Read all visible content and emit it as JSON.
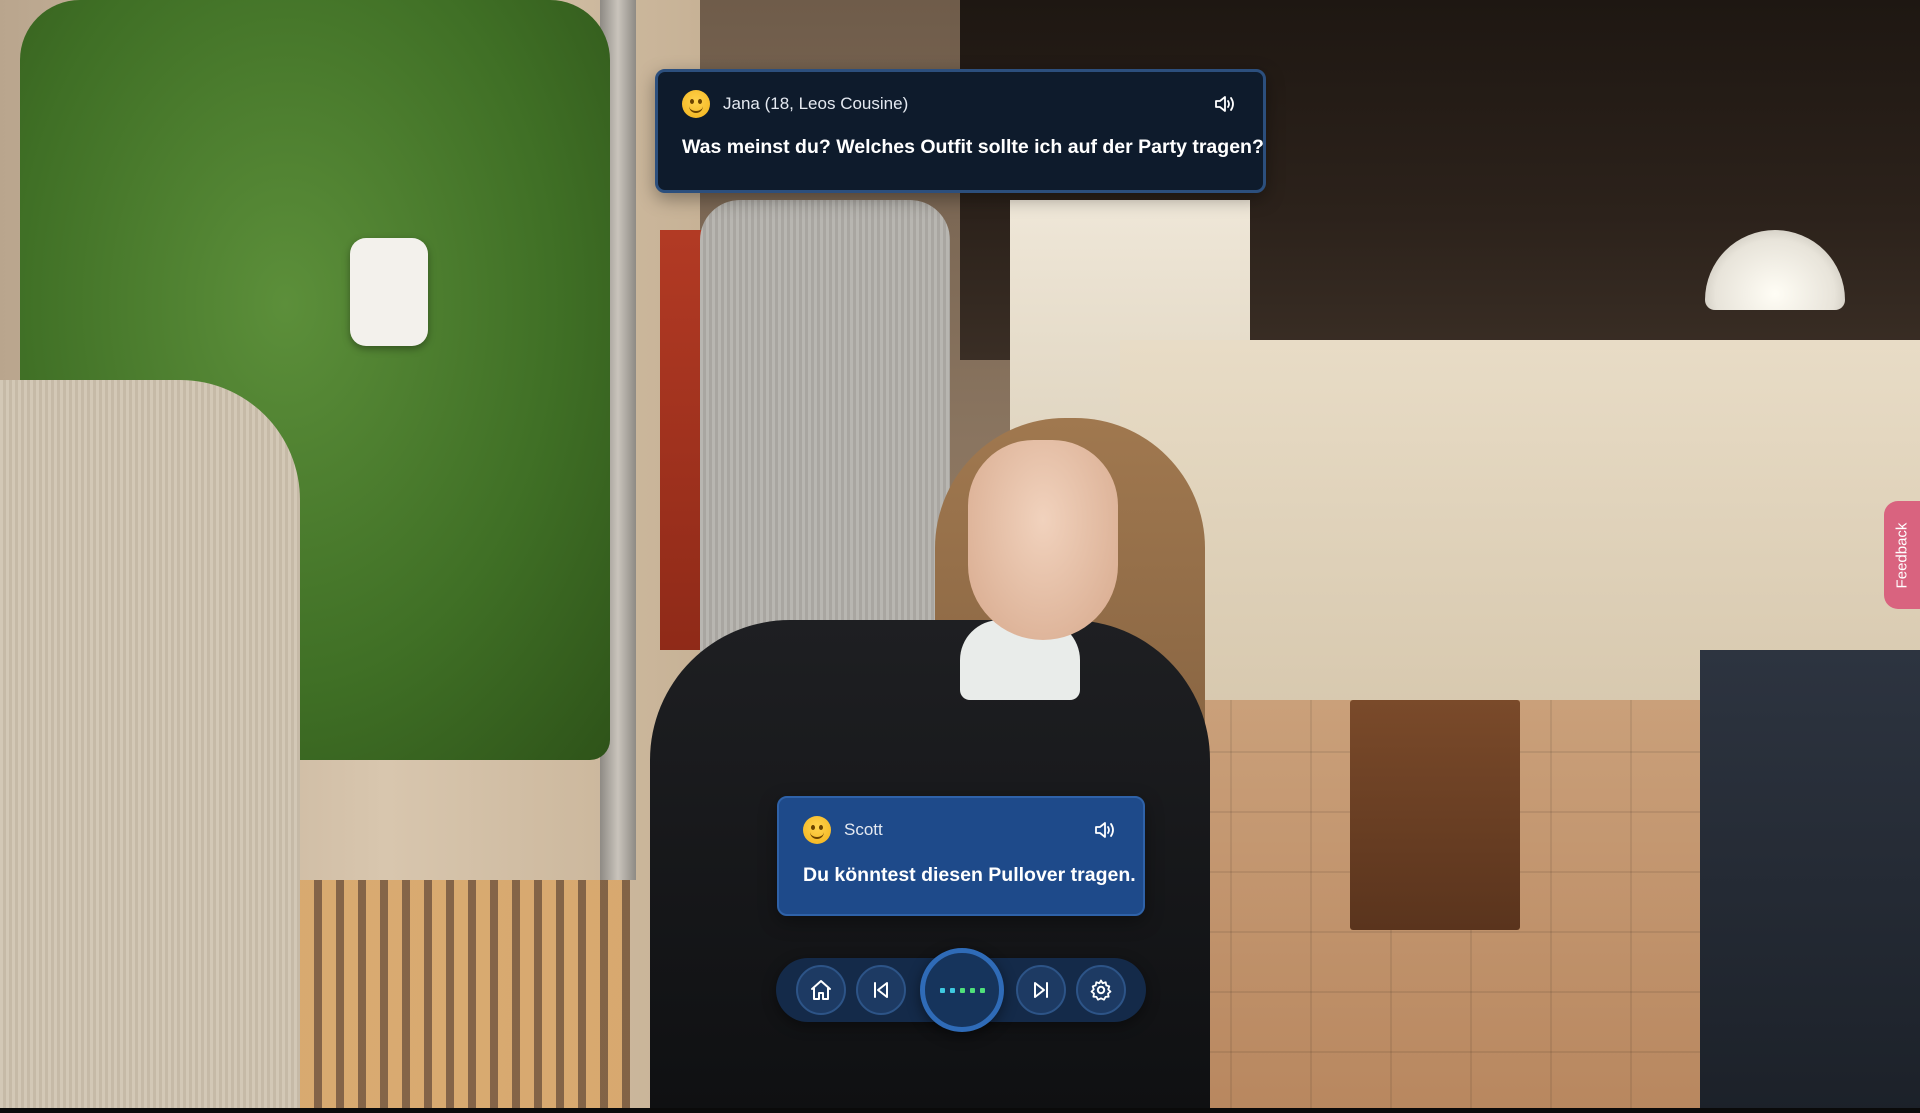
{
  "dialogue": {
    "npc": {
      "speaker": "Jana (18, Leos Cousine)",
      "text": "Was meinst du? Welches Outfit sollte ich auf der Party tragen?",
      "emoji": "smiling-face-icon",
      "sound_icon": "speaker-icon"
    },
    "player": {
      "speaker": "Scott",
      "text": "Du könntest diesen Pullover tragen.",
      "emoji": "smiling-face-icon",
      "sound_icon": "speaker-icon"
    }
  },
  "controls": {
    "home_icon": "home-icon",
    "prev_icon": "skip-back-icon",
    "center_icon": "listening-dots-icon",
    "next_icon": "skip-forward-icon",
    "settings_icon": "gear-icon"
  },
  "feedback": {
    "label": "Feedback",
    "color": "#d9637f"
  },
  "colors": {
    "npc_bubble": "#0e1b2c",
    "player_bubble": "#1e4a8a",
    "control_bar": "#142a49",
    "control_accent": "#2f6bb7"
  }
}
